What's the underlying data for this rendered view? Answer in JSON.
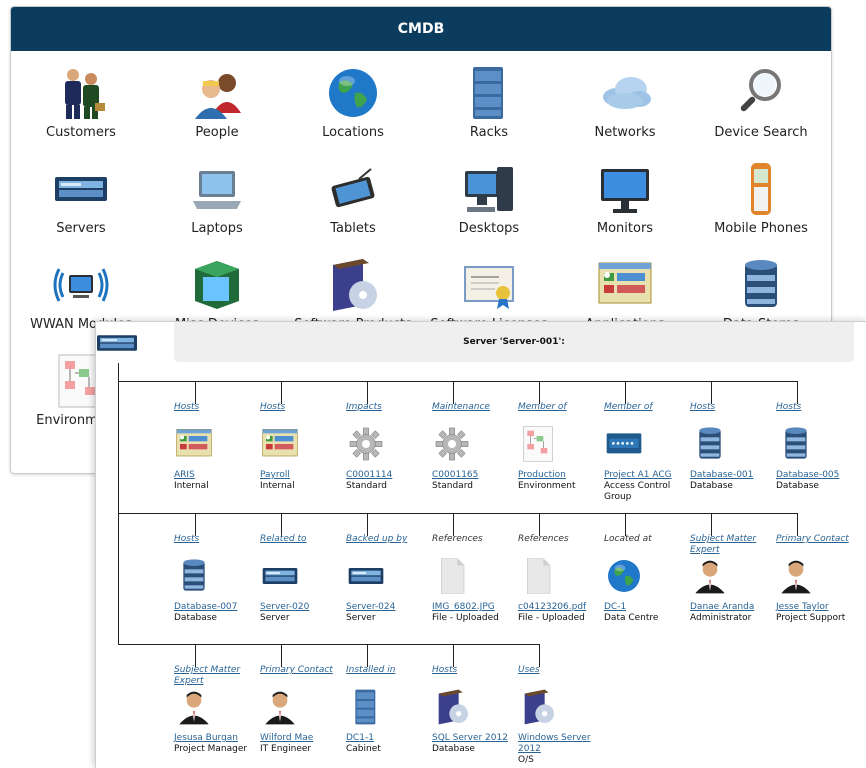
{
  "cmdb": {
    "title": "CMDB",
    "tiles": [
      {
        "label": "Customers",
        "icon": "customers-icon"
      },
      {
        "label": "People",
        "icon": "people-icon"
      },
      {
        "label": "Locations",
        "icon": "globe-icon"
      },
      {
        "label": "Racks",
        "icon": "rack-icon"
      },
      {
        "label": "Networks",
        "icon": "cloud-icon"
      },
      {
        "label": "Device Search",
        "icon": "magnifier-icon"
      },
      {
        "label": "Servers",
        "icon": "server-icon"
      },
      {
        "label": "Laptops",
        "icon": "laptop-icon"
      },
      {
        "label": "Tablets",
        "icon": "tablet-icon"
      },
      {
        "label": "Desktops",
        "icon": "desktop-icon"
      },
      {
        "label": "Monitors",
        "icon": "monitor-icon"
      },
      {
        "label": "Mobile Phones",
        "icon": "phone-icon"
      },
      {
        "label": "WWAN Modules",
        "icon": "wwan-icon"
      },
      {
        "label": "Misc Devices",
        "icon": "box-icon"
      },
      {
        "label": "Software Products",
        "icon": "software-icon"
      },
      {
        "label": "Software Licenses",
        "icon": "certificate-icon"
      },
      {
        "label": "Applications",
        "icon": "application-icon"
      },
      {
        "label": "Data Stores",
        "icon": "database-icon"
      },
      {
        "label": "Environments",
        "icon": "environment-icon"
      }
    ]
  },
  "server": {
    "title": "Server 'Server-001':",
    "rows": [
      [
        {
          "rel": "Hosts",
          "rel_link": true,
          "name": "ARIS",
          "type": "Internal",
          "icon": "application-icon"
        },
        {
          "rel": "Hosts",
          "rel_link": true,
          "name": "Payroll",
          "type": "Internal",
          "icon": "application-icon"
        },
        {
          "rel": "Impacts",
          "rel_link": true,
          "name": "C0001114",
          "type": "Standard",
          "icon": "gear-icon"
        },
        {
          "rel": "Maintenance",
          "rel_link": true,
          "name": "C0001165",
          "type": "Standard",
          "icon": "gear-icon"
        },
        {
          "rel": "Member of",
          "rel_link": true,
          "name": "Production",
          "type": "Environment",
          "icon": "environment-icon"
        },
        {
          "rel": "Member of",
          "rel_link": true,
          "name": "Project A1 ACG",
          "type": "Access Control Group",
          "icon": "password-icon"
        },
        {
          "rel": "Hosts",
          "rel_link": true,
          "name": "Database-001",
          "type": "Database",
          "icon": "database-icon"
        },
        {
          "rel": "Hosts",
          "rel_link": true,
          "name": "Database-005",
          "type": "Database",
          "icon": "database-icon"
        }
      ],
      [
        {
          "rel": "Hosts",
          "rel_link": true,
          "name": "Database-007",
          "type": "Database",
          "icon": "database-icon"
        },
        {
          "rel": "Related to",
          "rel_link": true,
          "name": "Server-020",
          "type": "Server",
          "icon": "server-icon"
        },
        {
          "rel": "Backed up by",
          "rel_link": true,
          "name": "Server-024",
          "type": "Server",
          "icon": "server-icon"
        },
        {
          "rel": "References",
          "rel_link": false,
          "name": "IMG_6802.JPG",
          "type": "File - Uploaded",
          "icon": "file-icon"
        },
        {
          "rel": "References",
          "rel_link": false,
          "name": "c04123206.pdf",
          "type": "File - Uploaded",
          "icon": "file-icon"
        },
        {
          "rel": "Located at",
          "rel_link": false,
          "name": "DC-1",
          "type": "Data Centre",
          "icon": "globe-icon"
        },
        {
          "rel": "Subject Matter Expert",
          "rel_link": true,
          "name": "Danae Aranda",
          "type": "Administrator",
          "icon": "person-icon"
        },
        {
          "rel": "Primary Contact",
          "rel_link": true,
          "name": "Jesse Taylor",
          "type": "Project Support",
          "icon": "person-icon"
        }
      ],
      [
        {
          "rel": "Subject Matter Expert",
          "rel_link": true,
          "name": "Jesusa Burgan",
          "type": "Project Manager",
          "icon": "person-icon"
        },
        {
          "rel": "Primary Contact",
          "rel_link": true,
          "name": "Wilford Mae",
          "type": "IT Engineer",
          "icon": "person-icon"
        },
        {
          "rel": "Installed in",
          "rel_link": true,
          "name": "DC1-1",
          "type": "Cabinet",
          "icon": "rack-icon"
        },
        {
          "rel": "Hosts",
          "rel_link": true,
          "name": "SQL Server 2012",
          "type": "Database",
          "icon": "software-icon"
        },
        {
          "rel": "Uses",
          "rel_link": true,
          "name": "Windows Server 2012",
          "type": "O/S",
          "icon": "software-icon"
        }
      ]
    ]
  },
  "colors": {
    "header": "#0b3c5d",
    "link": "#2a6496"
  }
}
